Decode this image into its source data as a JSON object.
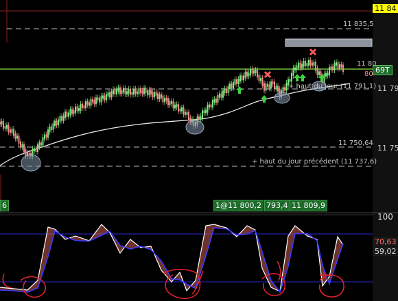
{
  "price_panel": {
    "axis_labels": [
      "11 79",
      "11 75"
    ],
    "price_boxes": {
      "top_price": "11 84",
      "current_price": "69T",
      "osc_upper_value": "70,63",
      "osc_lower_value": "59,02",
      "osc_scale_top": "100"
    },
    "levels": {
      "level_1": "11 835,5",
      "level_2": "11 750,64",
      "day_high": "+ haut du jour (11 791,1)",
      "prev_day_high": "+ haut du jour précédent (11 737,6)"
    },
    "partial_labels": {
      "right_label_a": "11 80",
      "right_label_b": "80",
      "right_label_c": "6"
    }
  },
  "bottom_tags": [
    "6",
    "1@11 800,2",
    "793,4",
    "11 809,9"
  ],
  "colors": {
    "background": "#000000",
    "bull_candle": "#7be57b",
    "bear_candle": "#f08a8a",
    "moving_average": "#e8e8e8",
    "support_line": "#72c23a",
    "oscillator_band": "#2a2ad0",
    "annotation_red": "#e0202a",
    "highlight_ellipse": "#8a9bb0",
    "arrow_up": "#3ed13e",
    "cross_marker": "#ff5a5a"
  },
  "icons": [
    "buy-arrow-icon",
    "sell-cross-icon"
  ]
}
